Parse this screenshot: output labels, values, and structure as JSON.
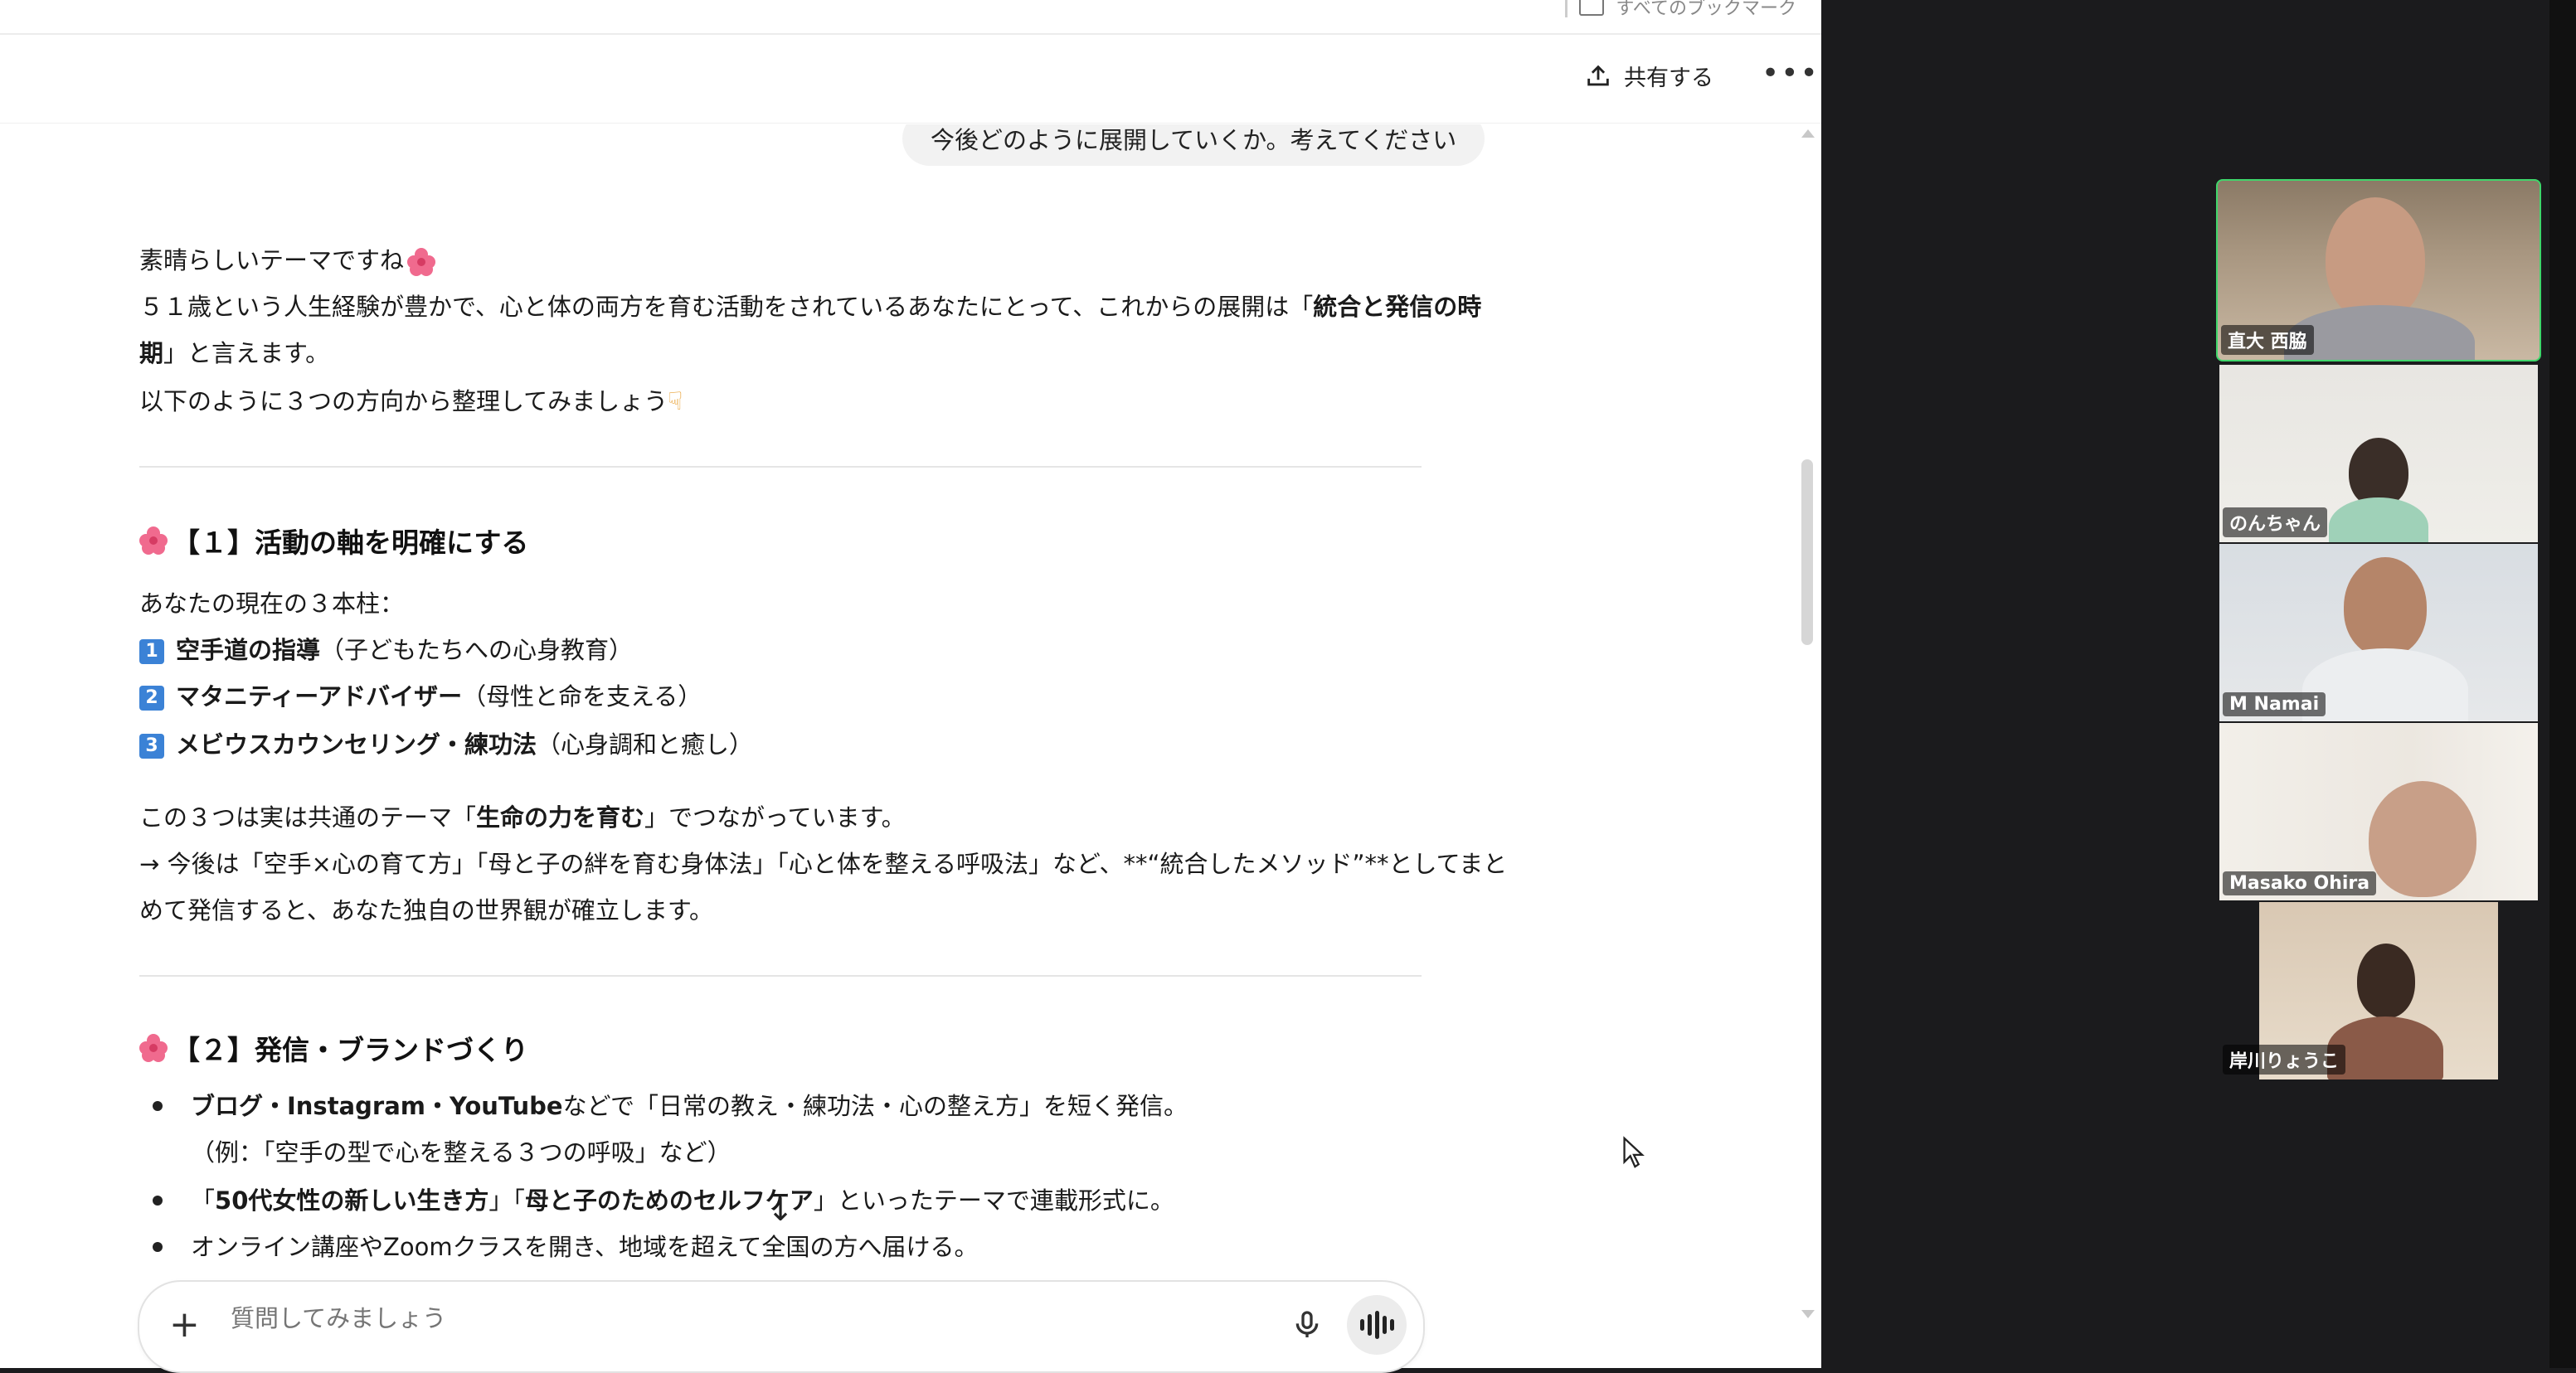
{
  "bookmarks": {
    "label": "すべてのブックマーク"
  },
  "header": {
    "share_label": "共有する",
    "more_label": "•••"
  },
  "conversation": {
    "user_message": "今後どのように展開していくか。考えてください",
    "intro_1": "素晴らしいテーマですね",
    "intro_2a": "５１歳という人生経験が豊かで、心と体の両方を育む活動をされているあなたにとって、これからの展開は「",
    "intro_2b": "統合と発信の時",
    "intro_3a": "期",
    "intro_3b": "」と言えます。",
    "intro_4": "以下のように３つの方向から整理してみましょう",
    "section1_title": "【１】活動の軸を明確にする",
    "pillars_label": "あなたの現在の３本柱：",
    "pillars": [
      {
        "num": "1",
        "title": "空手道の指導",
        "desc": "（子どもたちへの心身教育）"
      },
      {
        "num": "2",
        "title": "マタニティーアドバイザー",
        "desc": "（母性と命を支える）"
      },
      {
        "num": "3",
        "title": "メビウスカウンセリング・練功法",
        "desc": "（心身調和と癒し）"
      }
    ],
    "common_a": "この３つは実は共通のテーマ「",
    "common_b": "生命の力を育む",
    "common_c": "」でつながっています。",
    "future_1": "→ 今後は「空手×心の育て方」「母と子の絆を育む身体法」「心と体を整える呼吸法」など、**“統合したメソッド”**としてまと",
    "future_2": "めて発信すると、あなた独自の世界観が確立します。",
    "section2_title": "【２】発信・ブランドづくり",
    "b1a": "ブログ・Instagram・YouTube",
    "b1b": "などで「日常の教え・練功法・心の整え方」を短く発信。",
    "b1c": "（例：「空手の型で心を整える３つの呼吸」など）",
    "b2a": "「",
    "b2b": "50代女性の新しい生き方",
    "b2c": "」「",
    "b2d": "母と子のためのセルフケア",
    "b2e": "」といったテーマで連載形式に。",
    "b3": "オンライン講座やZoomクラスを開き、地域を超えて全国の方へ届ける。"
  },
  "composer": {
    "placeholder": "質問してみましょう"
  },
  "participants": [
    {
      "name": "直大 西脇",
      "active": true
    },
    {
      "name": "のんちゃん",
      "active": false
    },
    {
      "name": "M Namai",
      "active": false
    },
    {
      "name": "Masako Ohira",
      "active": false
    },
    {
      "name": "岸川りょうこ",
      "active": false
    }
  ],
  "colors": {
    "active_speaker": "#3fd66b",
    "number_badge": "#3b82d6",
    "flower": "#f06a8e"
  }
}
